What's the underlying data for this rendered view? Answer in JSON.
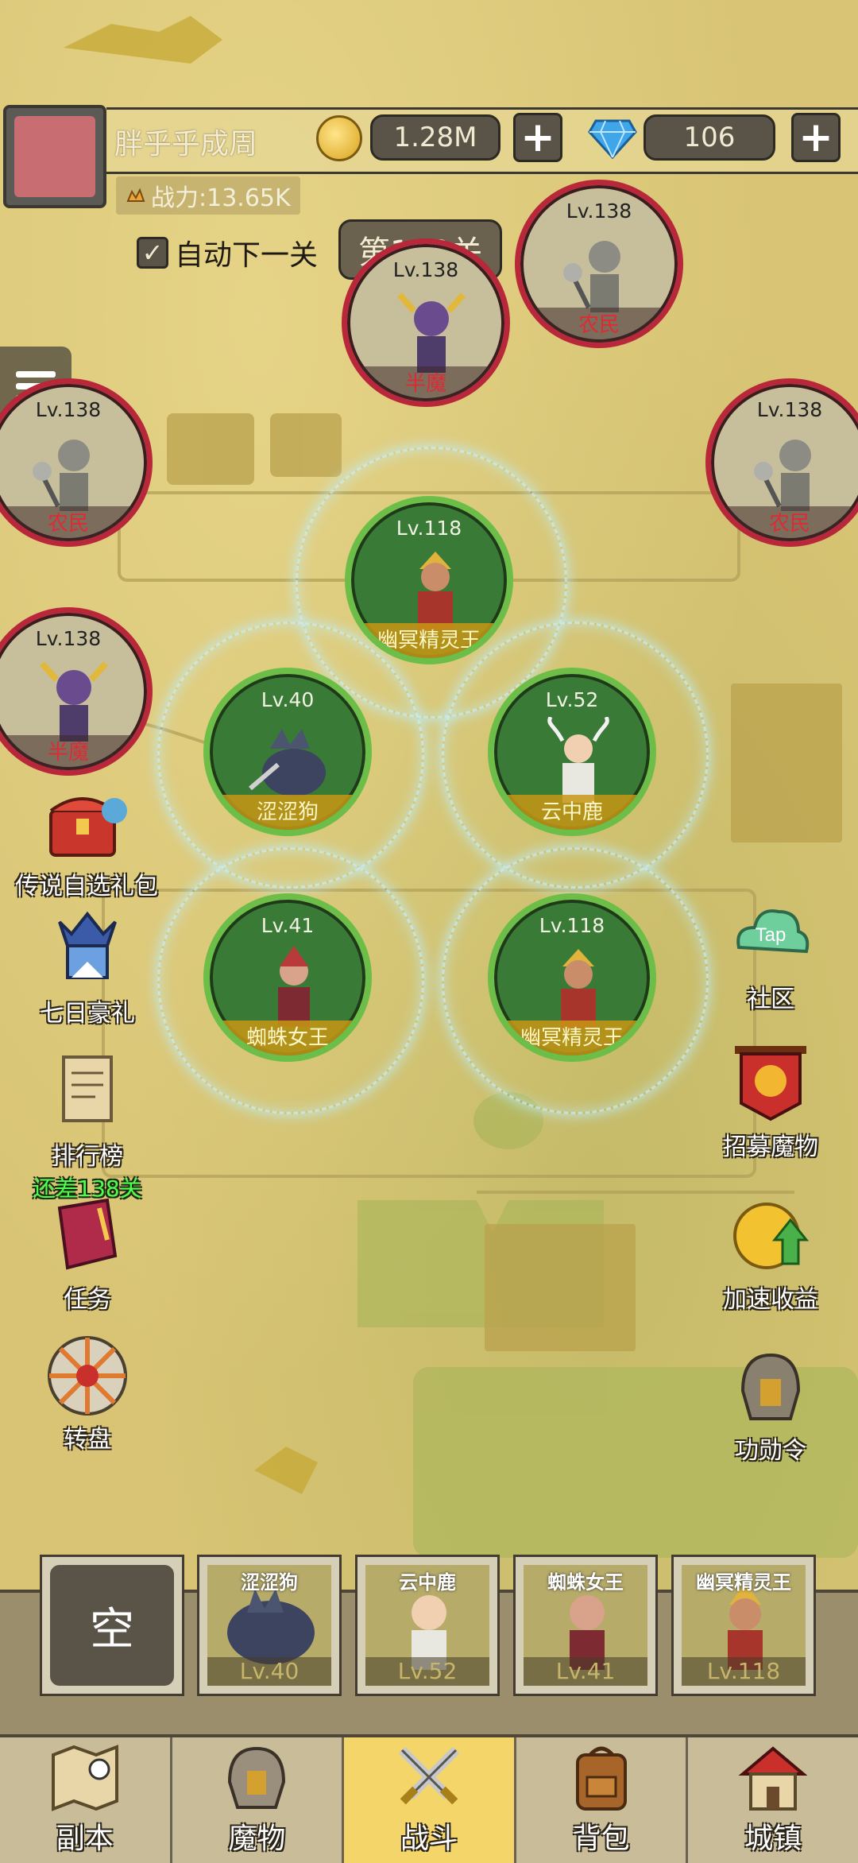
{
  "player": {
    "name": "胖乎乎成周",
    "power": "战力:13.65K"
  },
  "currency": {
    "gold": "1.28M",
    "gems": "106",
    "plus": "+"
  },
  "stage": {
    "auto_next_label": "自动下一关",
    "auto_next_checked": true,
    "current": "第163关"
  },
  "enemies": [
    {
      "level": "Lv.138",
      "name": "农民"
    },
    {
      "level": "Lv.138",
      "name": "半魔"
    },
    {
      "level": "Lv.138",
      "name": "农民"
    },
    {
      "level": "Lv.138",
      "name": "农民"
    },
    {
      "level": "Lv.138",
      "name": "半魔"
    }
  ],
  "allies": [
    {
      "level": "Lv.118",
      "name": "幽冥精灵王"
    },
    {
      "level": "Lv.40",
      "name": "涩涩狗"
    },
    {
      "level": "Lv.52",
      "name": "云中鹿"
    },
    {
      "level": "Lv.41",
      "name": "蜘蛛女王"
    },
    {
      "level": "Lv.118",
      "name": "幽冥精灵王"
    }
  ],
  "left_features": [
    {
      "label": "传说自选礼包",
      "icon": "treasure-chest-icon"
    },
    {
      "label": "七日豪礼",
      "icon": "knight-helmet-icon"
    },
    {
      "label": "排行榜",
      "sub": "还差138关",
      "icon": "scroll-icon"
    },
    {
      "label": "任务",
      "icon": "book-icon"
    },
    {
      "label": "转盘",
      "icon": "wheel-icon"
    }
  ],
  "right_features": [
    {
      "label": "社区",
      "icon": "tap-cloud-icon",
      "badge": "Tap"
    },
    {
      "label": "招募魔物",
      "icon": "banner-icon"
    },
    {
      "label": "加速收益",
      "icon": "coin-arrow-icon"
    },
    {
      "label": "功勋令",
      "icon": "helmet-icon"
    }
  ],
  "team": {
    "empty_label": "空",
    "slots": [
      {
        "name": "涩涩狗",
        "level": "Lv.40"
      },
      {
        "name": "云中鹿",
        "level": "Lv.52"
      },
      {
        "name": "蜘蛛女王",
        "level": "Lv.41"
      },
      {
        "name": "幽冥精灵王",
        "level": "Lv.118"
      }
    ]
  },
  "nav": [
    {
      "label": "副本",
      "icon": "map-icon"
    },
    {
      "label": "魔物",
      "icon": "monster-helmet-icon"
    },
    {
      "label": "战斗",
      "icon": "crossed-swords-icon",
      "active": true
    },
    {
      "label": "背包",
      "icon": "backpack-icon"
    },
    {
      "label": "城镇",
      "icon": "house-icon"
    }
  ]
}
